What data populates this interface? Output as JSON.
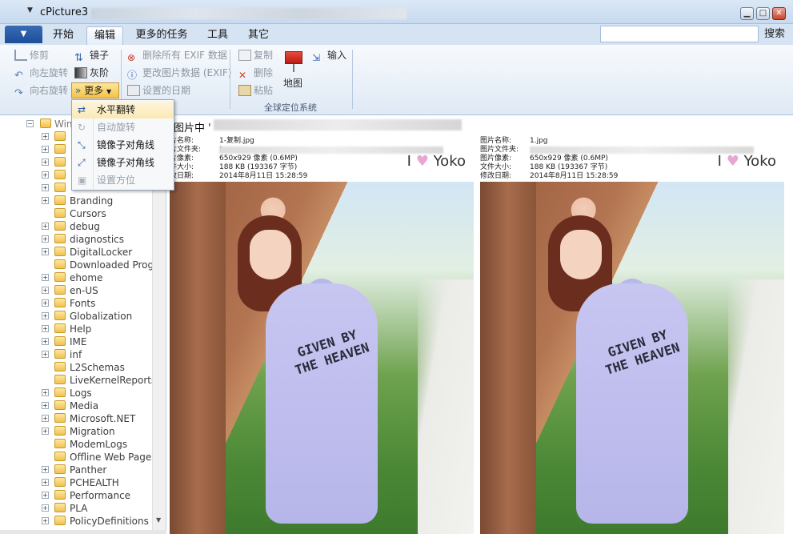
{
  "window": {
    "title": "cPicture3 -",
    "min_label": "▁",
    "max_label": "□",
    "close_label": "✕"
  },
  "tabs": [
    "开始",
    "编辑",
    "更多的任务",
    "工具",
    "其它"
  ],
  "search": {
    "button_label": "搜索",
    "value": ""
  },
  "ribbon": {
    "crop": "修剪",
    "rotate_left": "向左旋转",
    "rotate_right": "向右旋转",
    "mirror": "镜子",
    "grayscale": "灰阶",
    "more": "更多",
    "delete_exif": "删除所有 EXIF 数据",
    "edit_exif": "更改图片数据 (EXIF)",
    "set_date": "设置的日期",
    "copy": "复制",
    "remove": "删除",
    "paste": "粘贴",
    "map": "地图",
    "input": "输入",
    "group_label": "全球定位系统"
  },
  "dropdown": {
    "items": [
      {
        "label": "水平翻转",
        "enabled": true,
        "highlighted": true
      },
      {
        "label": "自动旋转",
        "enabled": false,
        "highlighted": false
      },
      {
        "label": "镜像子对角线",
        "enabled": true,
        "highlighted": false
      },
      {
        "label": "镜像子对角线",
        "enabled": true,
        "highlighted": false
      },
      {
        "label": "设置方位",
        "enabled": false,
        "highlighted": false
      }
    ]
  },
  "tree": {
    "root_label": "Wind",
    "items": [
      {
        "label": "Branding",
        "expander": true
      },
      {
        "label": "Cursors",
        "expander": false
      },
      {
        "label": "debug",
        "expander": true
      },
      {
        "label": "diagnostics",
        "expander": true
      },
      {
        "label": "DigitalLocker",
        "expander": true
      },
      {
        "label": "Downloaded Program",
        "expander": false
      },
      {
        "label": "ehome",
        "expander": true
      },
      {
        "label": "en-US",
        "expander": true
      },
      {
        "label": "Fonts",
        "expander": true
      },
      {
        "label": "Globalization",
        "expander": true
      },
      {
        "label": "Help",
        "expander": true
      },
      {
        "label": "IME",
        "expander": true
      },
      {
        "label": "inf",
        "expander": true
      },
      {
        "label": "L2Schemas",
        "expander": false
      },
      {
        "label": "LiveKernelReports",
        "expander": false
      },
      {
        "label": "Logs",
        "expander": true
      },
      {
        "label": "Media",
        "expander": true
      },
      {
        "label": "Microsoft.NET",
        "expander": true
      },
      {
        "label": "Migration",
        "expander": true
      },
      {
        "label": "ModemLogs",
        "expander": false
      },
      {
        "label": "Offline Web Pages",
        "expander": false
      },
      {
        "label": "Panther",
        "expander": true
      },
      {
        "label": "PCHEALTH",
        "expander": true
      },
      {
        "label": "Performance",
        "expander": true
      },
      {
        "label": "PLA",
        "expander": true
      },
      {
        "label": "PolicyDefinitions",
        "expander": true
      }
    ]
  },
  "preview": {
    "title_prefix": "图片中 '",
    "cards": [
      {
        "name_key": "片名称:",
        "name": "1-复制.jpg",
        "file_key": "片文件夹:",
        "file_value": "!",
        "pixels_key": "片像素:",
        "pixels": "650x929 像素 (0.6MP)",
        "size_key": "件大小:",
        "size": "188 KB (193367 字节)",
        "date_key": "改日期:",
        "date": "2014年8月11日 15:28:59",
        "watermark_prefix": "I",
        "watermark_heart": "♥",
        "watermark_text": "Yoko",
        "tee_text": "GIVEN BY THE HEAVEN"
      },
      {
        "name_key": "图片名称:",
        "name": "1.jpg",
        "file_key": "图片文件夹:",
        "file_value": "",
        "pixels_key": "图片像素:",
        "pixels": "650x929 像素 (0.6MP)",
        "size_key": "文件大小:",
        "size": "188 KB (193367 字节)",
        "date_key": "修改日期:",
        "date": "2014年8月11日 15:28:59",
        "watermark_prefix": "I",
        "watermark_heart": "♥",
        "watermark_text": "Yoko",
        "tee_text": "GIVEN BY THE HEAVEN"
      }
    ]
  }
}
